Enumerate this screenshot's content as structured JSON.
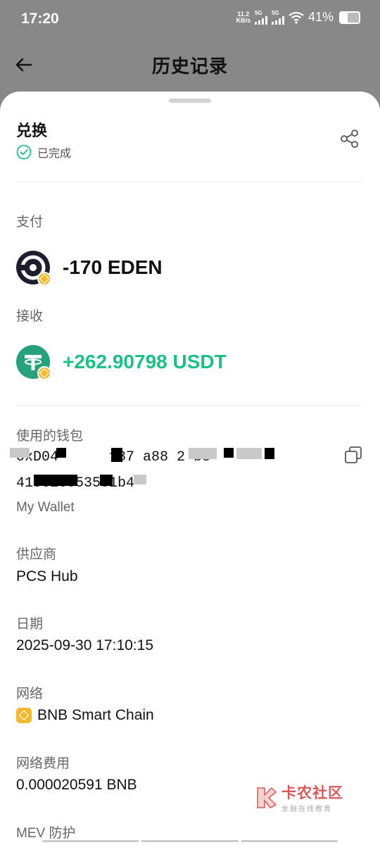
{
  "status_bar": {
    "time": "17:20",
    "net_speed_value": "11.2",
    "net_speed_unit": "KB/s",
    "sim1": "5G",
    "sim2": "5G",
    "battery": "41%"
  },
  "header": {
    "title": "历史记录"
  },
  "summary": {
    "type": "兑换",
    "status": "已完成"
  },
  "pay": {
    "label": "支付",
    "amount": "-170 EDEN"
  },
  "receive": {
    "label": "接收",
    "amount": "+262.90798 USDT"
  },
  "wallet": {
    "label": "使用的钱包",
    "address_line1": "0xD04 5897 f87 a88 2 b8",
    "address_line2": "415C16053581b4",
    "name": "My Wallet"
  },
  "provider": {
    "label": "供应商",
    "value": "PCS Hub"
  },
  "date": {
    "label": "日期",
    "value": "2025-09-30 17:10:15"
  },
  "network": {
    "label": "网络",
    "value": "BNB Smart Chain"
  },
  "fee": {
    "label": "网络费用",
    "value": "0.000020591 BNB"
  },
  "mev": {
    "label": "MEV 防护"
  },
  "watermark": {
    "main": "卡农社区",
    "sub": "金融在线教育"
  },
  "colors": {
    "positive": "#1DBF84",
    "bnb": "#F3BA2F",
    "overlay": "#888888"
  }
}
